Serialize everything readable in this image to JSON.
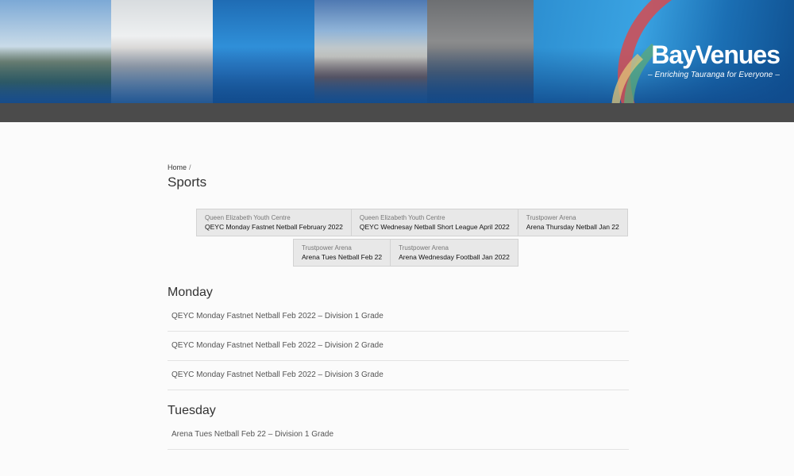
{
  "brand": {
    "name": "BayVenues",
    "tagline": "– Enriching Tauranga for Everyone –"
  },
  "colors": {
    "banner_blue": "#0d4a86",
    "nav_gray": "#4b4b4b",
    "tab_bg": "#e8e8e8"
  },
  "breadcrumb": {
    "home": "Home",
    "separator": "/"
  },
  "page_title": "Sports",
  "competitions_row1": [
    {
      "venue": "Queen Elizabeth Youth Centre",
      "league": "QEYC Monday Fastnet Netball February 2022"
    },
    {
      "venue": "Queen Elizabeth Youth Centre",
      "league": "QEYC Wednesay Netball Short League April 2022"
    },
    {
      "venue": "Trustpower Arena",
      "league": "Arena Thursday Netball Jan 22"
    }
  ],
  "competitions_row2": [
    {
      "venue": "Trustpower Arena",
      "league": "Arena Tues Netball Feb 22"
    },
    {
      "venue": "Trustpower Arena",
      "league": "Arena Wednesday Football Jan 2022"
    }
  ],
  "days": {
    "monday": {
      "heading": "Monday",
      "grades": [
        "QEYC Monday Fastnet Netball Feb 2022 – Division 1 Grade",
        "QEYC Monday Fastnet Netball Feb 2022 – Division 2 Grade",
        "QEYC Monday Fastnet Netball Feb 2022 – Division 3 Grade"
      ]
    },
    "tuesday": {
      "heading": "Tuesday",
      "grades": [
        "Arena Tues Netball Feb 22 – Division 1 Grade"
      ]
    }
  }
}
